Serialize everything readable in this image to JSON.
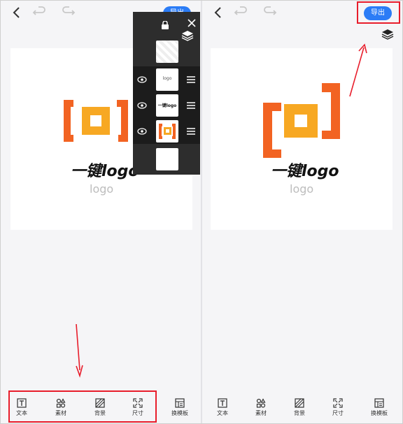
{
  "left": {
    "export_label": "导出",
    "logo_title": "一键logo",
    "logo_sub": "logo",
    "layers": {
      "row2_text": "logo",
      "row3_text": "一键logo"
    },
    "tools": [
      {
        "label": "文本",
        "icon": "text-icon"
      },
      {
        "label": "素材",
        "icon": "assets-icon"
      },
      {
        "label": "背景",
        "icon": "background-icon"
      },
      {
        "label": "尺寸",
        "icon": "resize-icon"
      },
      {
        "label": "换模板",
        "icon": "template-icon"
      }
    ]
  },
  "right": {
    "export_label": "导出",
    "logo_title": "一键logo",
    "logo_sub": "logo",
    "tools": [
      {
        "label": "文本",
        "icon": "text-icon"
      },
      {
        "label": "素材",
        "icon": "assets-icon"
      },
      {
        "label": "背景",
        "icon": "background-icon"
      },
      {
        "label": "尺寸",
        "icon": "resize-icon"
      },
      {
        "label": "换模板",
        "icon": "template-icon"
      }
    ]
  },
  "colors": {
    "accent_blue": "#2b7cf6",
    "logo_orange": "#f26322",
    "logo_yellow": "#f7a823",
    "annotation_red": "#e81d2b"
  }
}
